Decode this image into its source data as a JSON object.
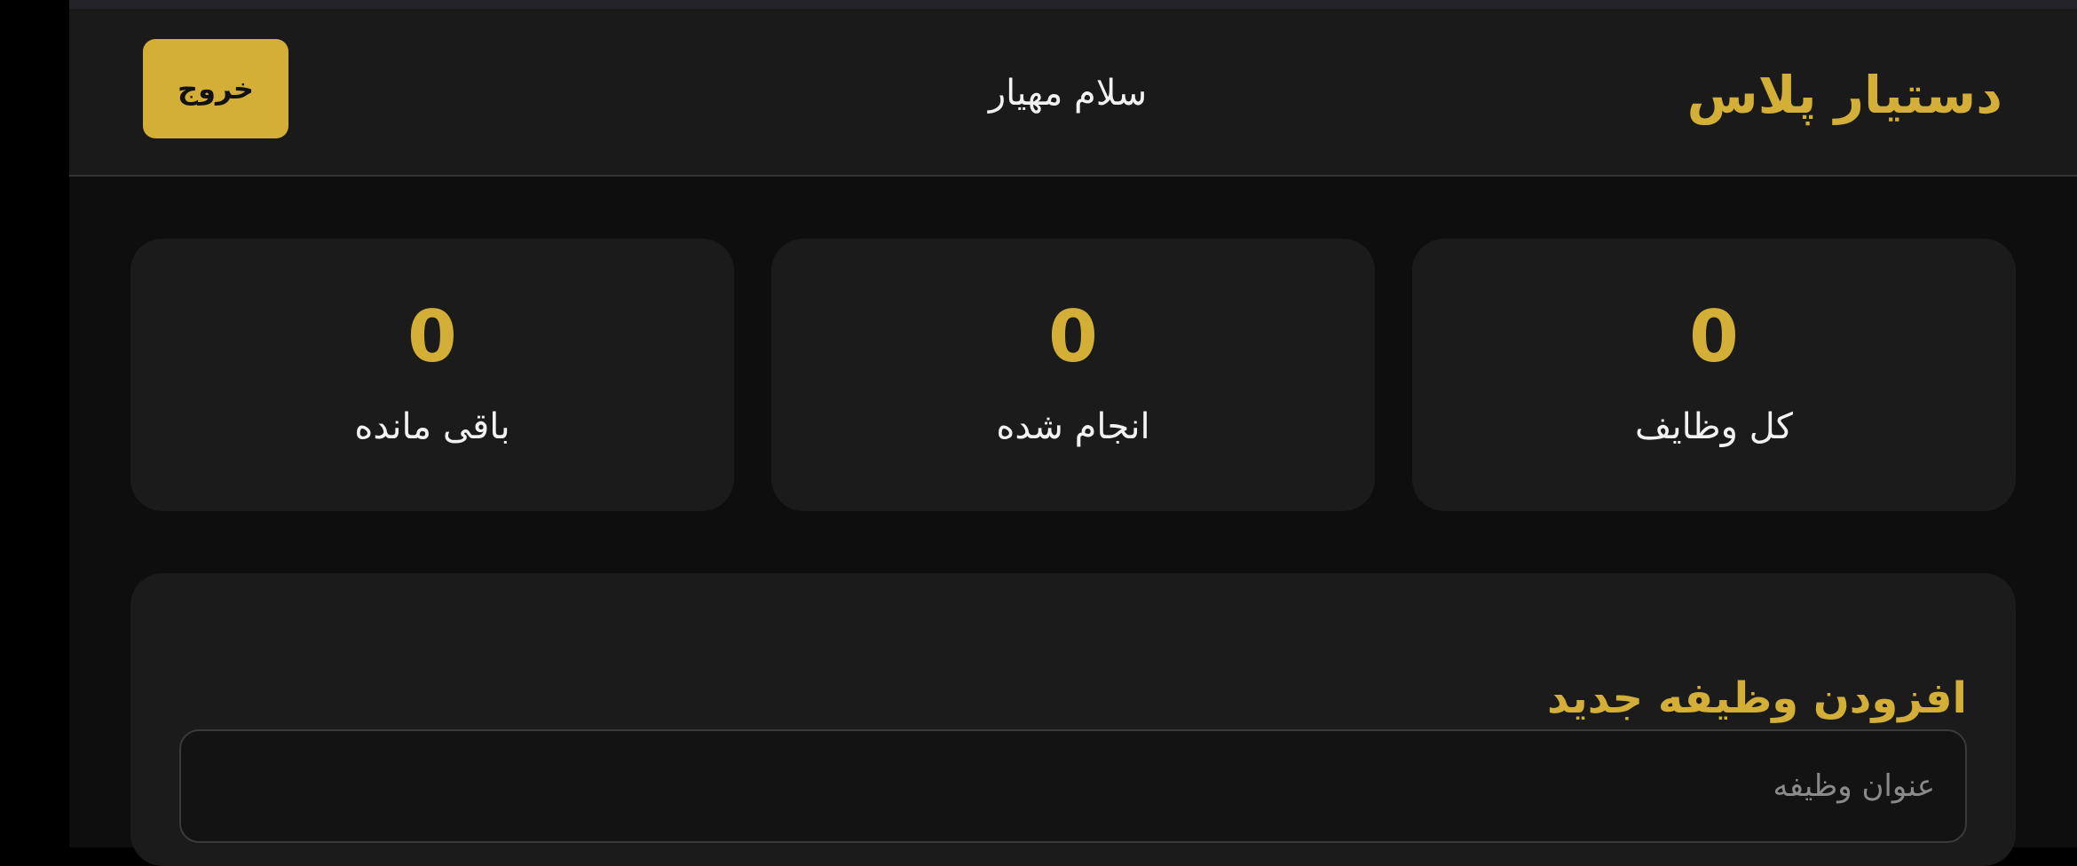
{
  "header": {
    "brand": "دستیار پلاس",
    "greeting": "سلام مهیار",
    "logout_label": "خروج"
  },
  "stats": [
    {
      "value": "0",
      "label": "کل وظایف"
    },
    {
      "value": "0",
      "label": "انجام شده"
    },
    {
      "value": "0",
      "label": "باقی مانده"
    }
  ],
  "add_task": {
    "title": "افزودن وظیفه جدید",
    "title_placeholder": "عنوان وظیفه"
  },
  "colors": {
    "accent": "#d4af37",
    "background": "#0e0e0e",
    "card": "#1b1b1b"
  }
}
